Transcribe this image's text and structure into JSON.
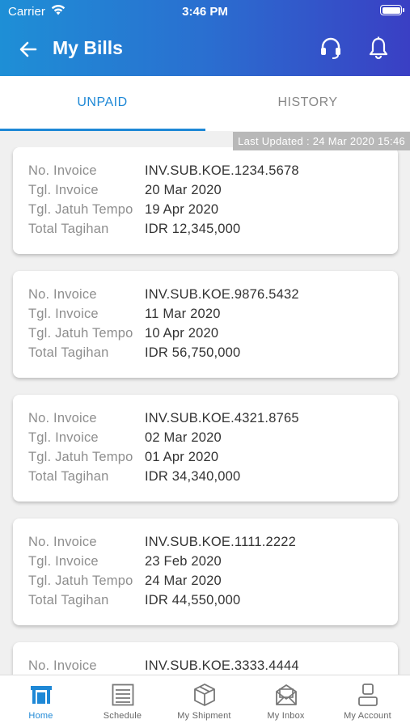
{
  "status_bar": {
    "carrier": "Carrier",
    "time": "3:46 PM"
  },
  "header": {
    "title": "My Bills",
    "icons": [
      "back-arrow-icon",
      "headset-icon",
      "bell-icon"
    ]
  },
  "tabs": [
    {
      "label": "UNPAID",
      "active": true
    },
    {
      "label": "HISTORY",
      "active": false
    }
  ],
  "last_updated": "Last Updated : 24 Mar 2020  15:46",
  "labels": {
    "invoice_no": "No. Invoice",
    "invoice_date": "Tgl. Invoice",
    "due_date": "Tgl. Jatuh Tempo",
    "total": "Total Tagihan"
  },
  "bills": [
    {
      "invoice_no": "INV.SUB.KOE.1234.5678",
      "invoice_date": "20 Mar 2020",
      "due_date": "19 Apr 2020",
      "total": "IDR 12,345,000"
    },
    {
      "invoice_no": "INV.SUB.KOE.9876.5432",
      "invoice_date": "11 Mar 2020",
      "due_date": "10 Apr 2020",
      "total": "IDR 56,750,000"
    },
    {
      "invoice_no": "INV.SUB.KOE.4321.8765",
      "invoice_date": "02 Mar 2020",
      "due_date": "01 Apr 2020",
      "total": "IDR 34,340,000"
    },
    {
      "invoice_no": "INV.SUB.KOE.1111.2222",
      "invoice_date": "23 Feb 2020",
      "due_date": "24 Mar 2020",
      "total": "IDR 44,550,000"
    },
    {
      "invoice_no": "INV.SUB.KOE.3333.4444"
    }
  ],
  "bottom_nav": [
    {
      "label": "Home",
      "icon": "home-icon",
      "active": true
    },
    {
      "label": "Schedule",
      "icon": "schedule-icon",
      "active": false
    },
    {
      "label": "My Shipment",
      "icon": "shipment-box-icon",
      "active": false
    },
    {
      "label": "My Inbox",
      "icon": "inbox-icon",
      "active": false
    },
    {
      "label": "My Account",
      "icon": "account-icon",
      "active": false
    }
  ],
  "colors": {
    "accent": "#1e88d6",
    "header_start": "#1e8fd6",
    "header_end": "#3a3fc4"
  }
}
